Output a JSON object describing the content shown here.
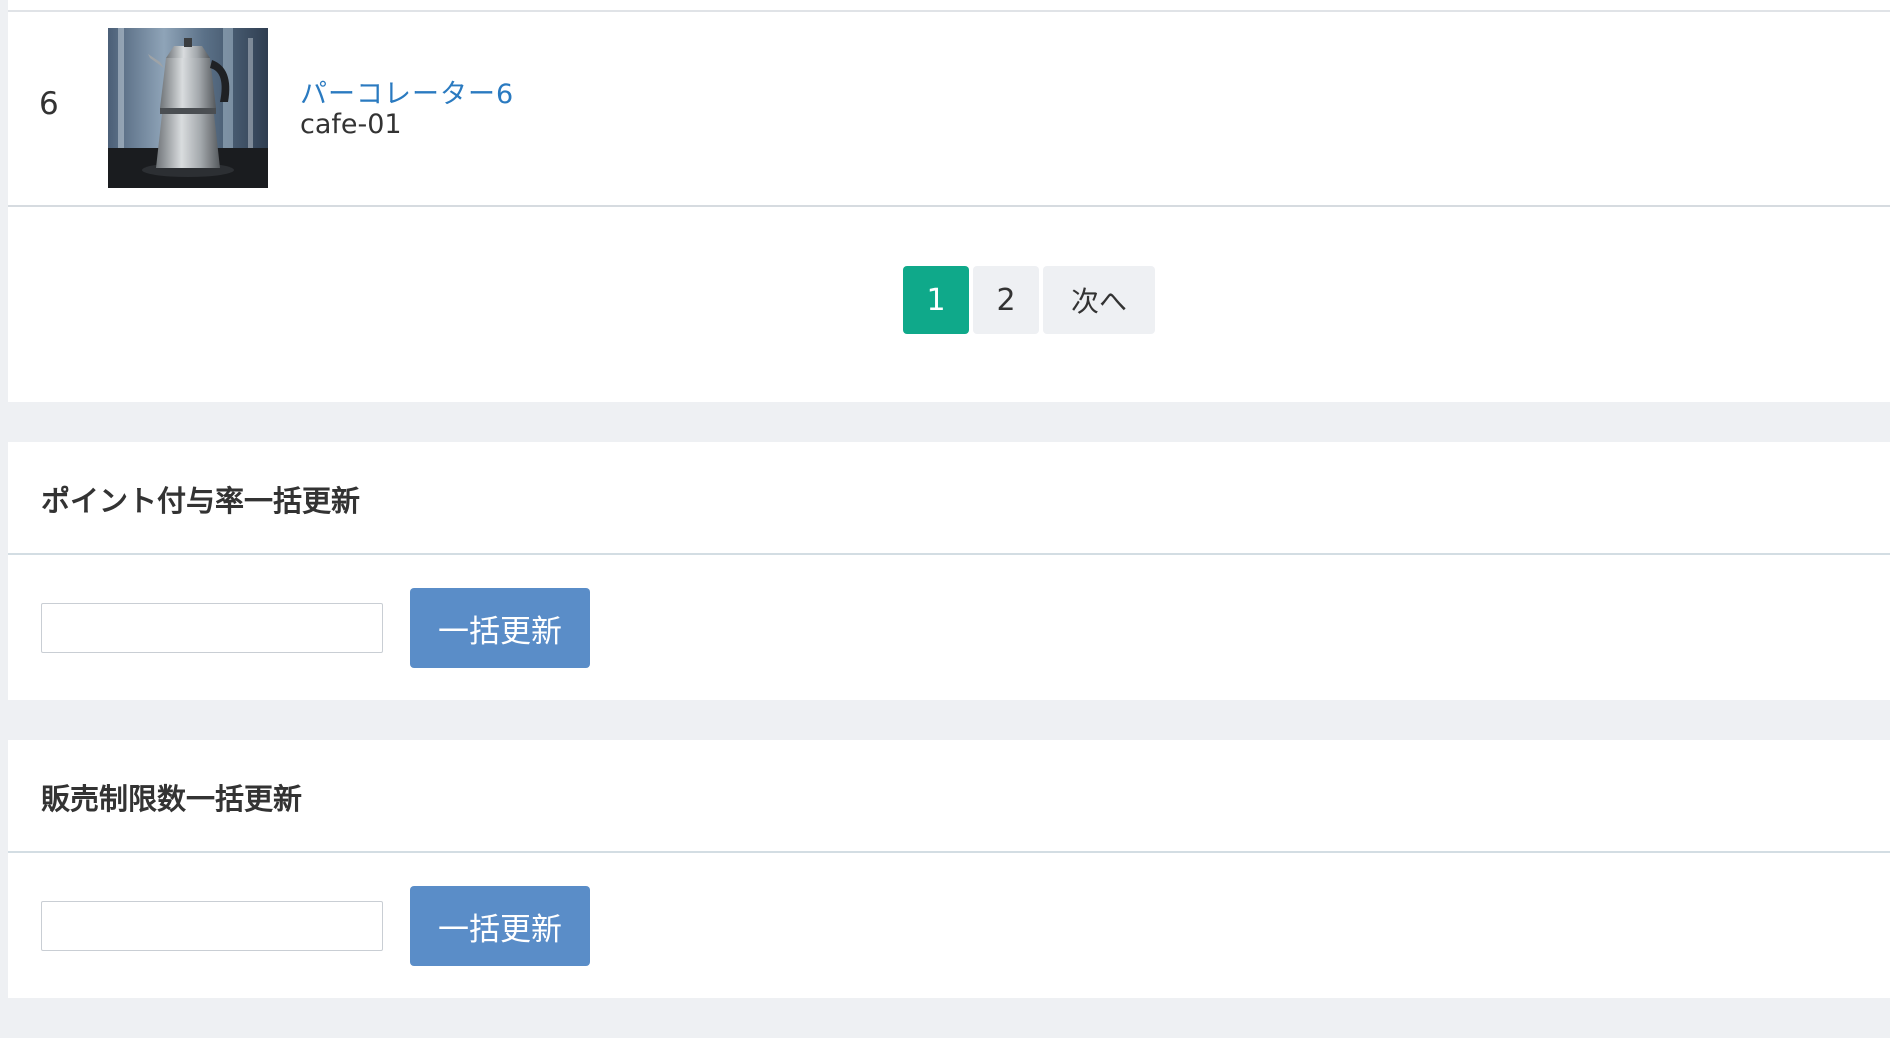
{
  "product": {
    "index": "6",
    "name": "パーコレーター6",
    "code": "cafe-01",
    "image_icon": "percolator-photo"
  },
  "pagination": {
    "pages": [
      "1",
      "2"
    ],
    "current": "1",
    "next_label": "次へ"
  },
  "point_rate_update": {
    "title": "ポイント付与率一括更新",
    "input_value": "",
    "button_label": "一括更新"
  },
  "sales_limit_update": {
    "title": "販売制限数一括更新",
    "input_value": "",
    "button_label": "一括更新"
  },
  "colors": {
    "page_bg": "#eef0f3",
    "link": "#2a7ac0",
    "active_page": "#0fa98a",
    "primary_button": "#5a8dc8"
  }
}
